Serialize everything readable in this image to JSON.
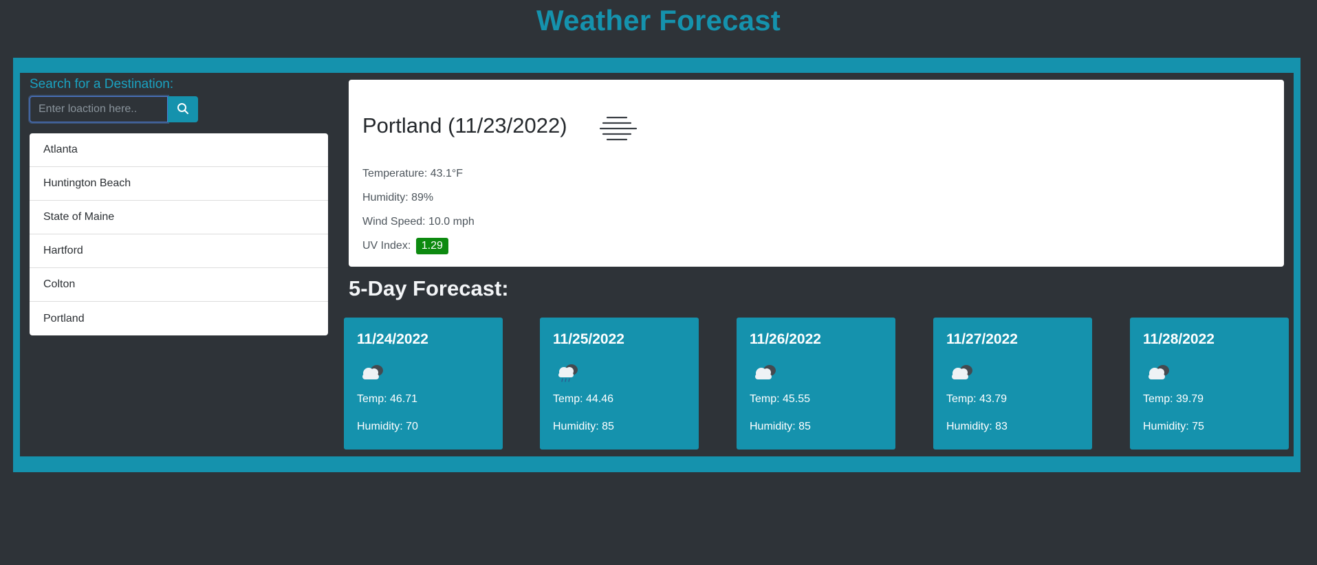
{
  "header": {
    "title": "Weather Forecast"
  },
  "search": {
    "label": "Search for a Destination:",
    "placeholder": "Enter loaction here..",
    "value": "",
    "button_icon": "search-icon"
  },
  "cities": [
    "Atlanta",
    "Huntington Beach",
    "State of Maine",
    "Hartford",
    "Colton",
    "Portland"
  ],
  "current": {
    "title": "Portland (11/23/2022)",
    "icon": "mist-icon",
    "temperature": "Temperature: 43.1°F",
    "humidity": "Humidity: 89%",
    "wind": "Wind Speed: 10.0 mph",
    "uv_label": "UV Index:",
    "uv_value": "1.29",
    "uv_color": "#0d8a10"
  },
  "forecast": {
    "heading": "5-Day Forecast:",
    "days": [
      {
        "date": "11/24/2022",
        "icon": "cloud-icon",
        "temp": "Temp: 46.71",
        "humidity": "Humidity: 70"
      },
      {
        "date": "11/25/2022",
        "icon": "rain-cloud-icon",
        "temp": "Temp: 44.46",
        "humidity": "Humidity: 85"
      },
      {
        "date": "11/26/2022",
        "icon": "cloud-icon",
        "temp": "Temp: 45.55",
        "humidity": "Humidity: 85"
      },
      {
        "date": "11/27/2022",
        "icon": "cloud-icon",
        "temp": "Temp: 43.79",
        "humidity": "Humidity: 83"
      },
      {
        "date": "11/28/2022",
        "icon": "cloud-icon",
        "temp": "Temp: 39.79",
        "humidity": "Humidity: 75"
      }
    ]
  },
  "colors": {
    "accent": "#1592ad",
    "background": "#2e3338",
    "uv_badge": "#0d8a10"
  }
}
